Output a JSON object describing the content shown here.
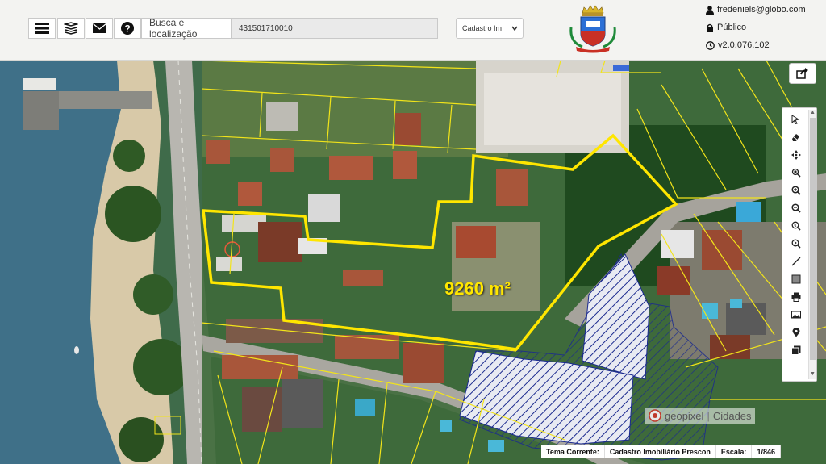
{
  "header": {
    "search_label": "Busca e localização",
    "search_value": "431501710010",
    "layer_select": "Cadastro Im",
    "user_email": "fredeniels@globo.com",
    "visibility": "Público",
    "version": "v2.0.076.102"
  },
  "map": {
    "area_label": "9260 m²",
    "brand": "geopixel",
    "brand_suffix": "Cidades"
  },
  "toolbar": {
    "tools": [
      "pointer-icon",
      "eraser-icon",
      "pan-icon",
      "zoom-box-icon",
      "zoom-in-icon",
      "zoom-out-icon",
      "zoom-prev-icon",
      "zoom-next-icon",
      "measure-line-icon",
      "measure-area-icon",
      "print-icon",
      "image-icon",
      "marker-icon",
      "layers-icon"
    ]
  },
  "status": {
    "theme_label": "Tema Corrente:",
    "theme_value": "Cadastro Imobiliário Prescon",
    "scale_label": "Escala:",
    "scale_value": "1/846"
  },
  "colors": {
    "highlight": "#ffe600",
    "parcel_line": "#f2e41a",
    "hatch": "#1b2a8f",
    "water": "#3d6f82"
  }
}
